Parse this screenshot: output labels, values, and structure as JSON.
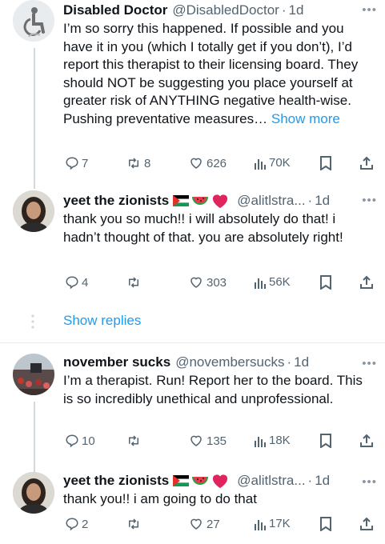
{
  "tweets": [
    {
      "name": "Disabled Doctor",
      "handle": "@DisabledDoctor",
      "time": "1d",
      "text": "I’m so sorry this happened. If possible and you have it in you (which I totally get if you don’t), I’d report this therapist to their licensing board. They should NOT be suggesting you place yourself at greater risk of ANYTHING negative health-wise. Pushing preventative measures…",
      "show_more": "Show more",
      "replies": "7",
      "retweets": "8",
      "likes": "626",
      "views": "70K"
    },
    {
      "name": "yeet the zionists",
      "handle": "@alitlstra...",
      "time": "1d",
      "text": "thank you so much!! i will absolutely do that! i hadn’t thought of that. you are absolutely right!",
      "replies": "4",
      "retweets": "",
      "likes": "303",
      "views": "56K"
    },
    {
      "name": "november sucks",
      "handle": "@novembersucks",
      "time": "1d",
      "text": "I’m a therapist. Run! Report her to the board. This is so incredibly unethical and unprofessional.",
      "replies": "10",
      "retweets": "",
      "likes": "135",
      "views": "18K"
    },
    {
      "name": "yeet the zionists",
      "handle": "@alitlstra...",
      "time": "1d",
      "text": "thank you!! i am going to do that",
      "replies": "2",
      "retweets": "",
      "likes": "27",
      "views": "17K"
    }
  ],
  "show_replies": "Show replies",
  "more_glyph": "•••",
  "dot": "·",
  "colors": {
    "link": "#1d9bf0",
    "muted": "#536471",
    "text": "#0f1419"
  }
}
